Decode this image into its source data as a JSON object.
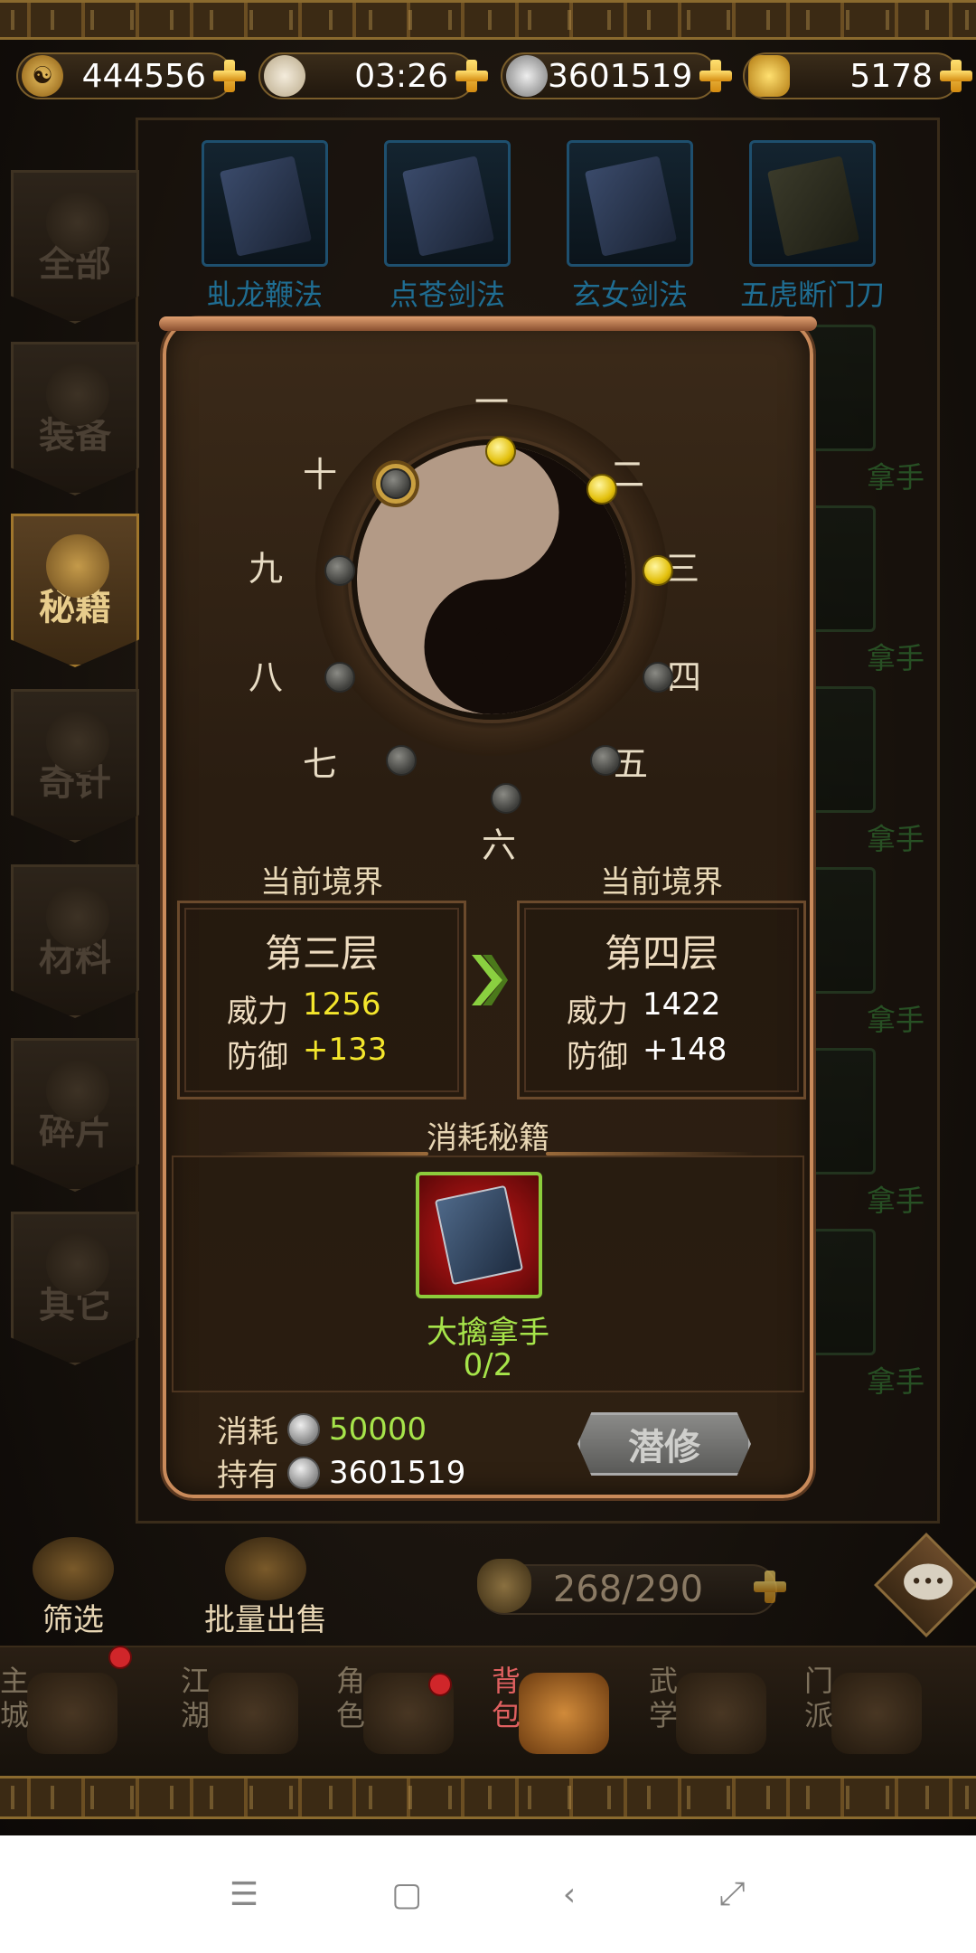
{
  "currencies": [
    {
      "icon": "yin-yang-coin-icon",
      "value": "444556"
    },
    {
      "icon": "bun-stamina-icon",
      "value": "03:26"
    },
    {
      "icon": "silver-coin-icon",
      "value": "3601519"
    },
    {
      "icon": "gold-ingot-icon",
      "value": "5178"
    }
  ],
  "left_tabs": [
    {
      "label": "全部",
      "active": false
    },
    {
      "label": "装备",
      "active": false
    },
    {
      "label": "秘籍",
      "active": true
    },
    {
      "label": "奇针",
      "active": false
    },
    {
      "label": "材料",
      "active": false
    },
    {
      "label": "碎片",
      "active": false
    },
    {
      "label": "其它",
      "active": false
    }
  ],
  "grid_top_row": [
    "虬龙鞭法",
    "点苍剑法",
    "玄女剑法",
    "五虎断门刀"
  ],
  "grid_side_labels": [
    "拿手",
    "拿手",
    "拿手",
    "拿手",
    "拿手",
    "拿手"
  ],
  "wheel": {
    "numerals": [
      "一",
      "二",
      "三",
      "四",
      "五",
      "六",
      "七",
      "八",
      "九",
      "十"
    ],
    "lit_count": 3,
    "current_node": 10
  },
  "current_level": {
    "heading": "当前境界",
    "title": "第三层",
    "power_label": "威力",
    "power": "1256",
    "defense_label": "防御",
    "defense": "+133"
  },
  "next_level": {
    "heading": "当前境界",
    "title": "第四层",
    "power_label": "威力",
    "power": "1422",
    "defense_label": "防御",
    "defense": "+148"
  },
  "consume": {
    "title": "消耗秘籍",
    "book_name": "大擒拿手",
    "book_count": "0/2"
  },
  "cost": {
    "consume_label": "消耗",
    "consume_value": "50000",
    "own_label": "持有",
    "own_value": "3601519",
    "button": "潜修"
  },
  "actions": {
    "filter": "筛选",
    "bulk_sell": "批量出售",
    "capacity": "268/290"
  },
  "nav": [
    {
      "label": "主城",
      "badge": true,
      "active": false
    },
    {
      "label": "江湖",
      "badge": false,
      "active": false
    },
    {
      "label": "角色",
      "badge": true,
      "active": false
    },
    {
      "label": "背包",
      "badge": false,
      "active": true
    },
    {
      "label": "武学",
      "badge": false,
      "active": false
    },
    {
      "label": "门派",
      "badge": false,
      "active": false
    }
  ],
  "android_nav": [
    "menu",
    "home",
    "back",
    "screenshot"
  ]
}
